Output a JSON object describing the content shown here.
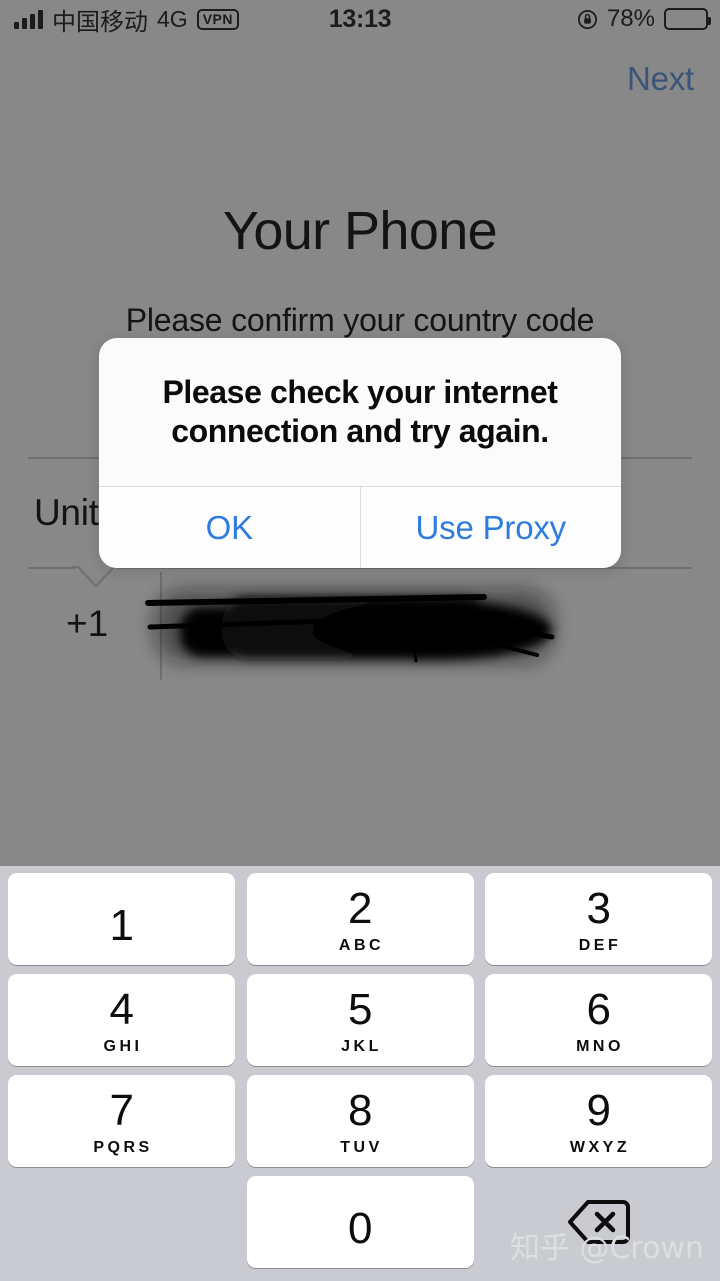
{
  "status_bar": {
    "carrier": "中国移动",
    "network_type": "4G",
    "vpn_label": "VPN",
    "time": "13:13",
    "battery_percent": "78%",
    "signal_bars": 4,
    "rotation_lock_icon": "rotation-lock-icon",
    "battery_icon": "battery-icon"
  },
  "nav": {
    "next_label": "Next"
  },
  "content": {
    "title": "Your Phone",
    "subtitle": "Please confirm your country code",
    "country_name": "United States",
    "dial_code": "+1",
    "phone_number_value": "",
    "phone_number_redacted": true
  },
  "alert": {
    "message": "Please check your internet connection and try again.",
    "buttons": [
      {
        "label": "OK",
        "name": "alert-ok-button"
      },
      {
        "label": "Use Proxy",
        "name": "alert-use-proxy-button"
      }
    ],
    "accent_color": "#2f7ce0"
  },
  "keypad": {
    "rows": [
      [
        {
          "digit": "1",
          "letters": ""
        },
        {
          "digit": "2",
          "letters": "ABC"
        },
        {
          "digit": "3",
          "letters": "DEF"
        }
      ],
      [
        {
          "digit": "4",
          "letters": "GHI"
        },
        {
          "digit": "5",
          "letters": "JKL"
        },
        {
          "digit": "6",
          "letters": "MNO"
        }
      ],
      [
        {
          "digit": "7",
          "letters": "PQRS"
        },
        {
          "digit": "8",
          "letters": "TUV"
        },
        {
          "digit": "9",
          "letters": "WXYZ"
        }
      ]
    ],
    "zero": {
      "digit": "0",
      "letters": ""
    },
    "delete_icon": "backspace-delete-icon",
    "background_color": "#c9cbd1"
  },
  "watermark": {
    "text": "知乎 @Crown"
  }
}
